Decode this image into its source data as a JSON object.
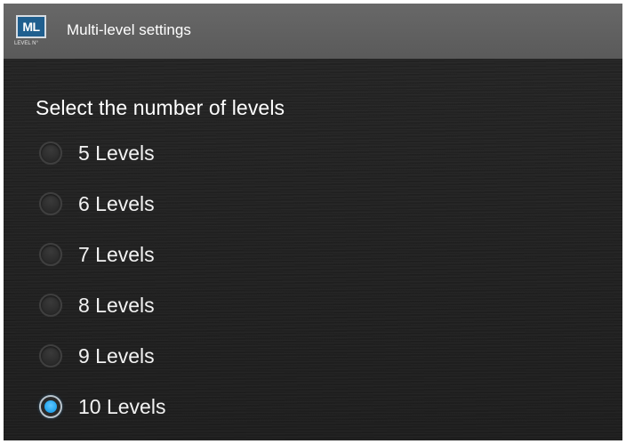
{
  "app": {
    "title": "Multi-level settings",
    "logo_text": "ML",
    "logo_subtext": "LEVEL N°",
    "logo_icon": "ml-logo-icon"
  },
  "main": {
    "heading": "Select the number of levels",
    "selected_value": "10 Levels",
    "options": [
      {
        "label": "5 Levels",
        "checked": false
      },
      {
        "label": "6 Levels",
        "checked": false
      },
      {
        "label": "7 Levels",
        "checked": false
      },
      {
        "label": "8 Levels",
        "checked": false
      },
      {
        "label": "9 Levels",
        "checked": false
      },
      {
        "label": "10 Levels",
        "checked": true
      }
    ]
  },
  "colors": {
    "appbar": "#5f5f5f",
    "background": "#222222",
    "accent": "#29a8f0",
    "logo": "#1f5f8f"
  }
}
